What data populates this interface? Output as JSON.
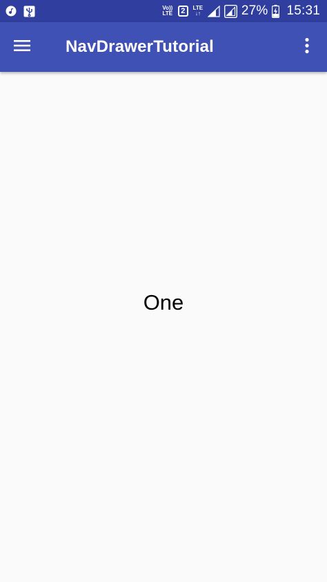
{
  "status_bar": {
    "volte_label_top": "Vo))",
    "volte_label_bottom": "LTE",
    "sim_slot": "2",
    "lte_label": "LTE",
    "battery_percent": "27%",
    "time": "15:31"
  },
  "app_bar": {
    "title": "NavDrawerTutorial",
    "background_color": "#3f51b5",
    "status_bar_color": "#303f9f"
  },
  "content": {
    "text": "One"
  },
  "icons": {
    "menu": "hamburger-menu-icon",
    "overflow": "more-vert-icon"
  }
}
